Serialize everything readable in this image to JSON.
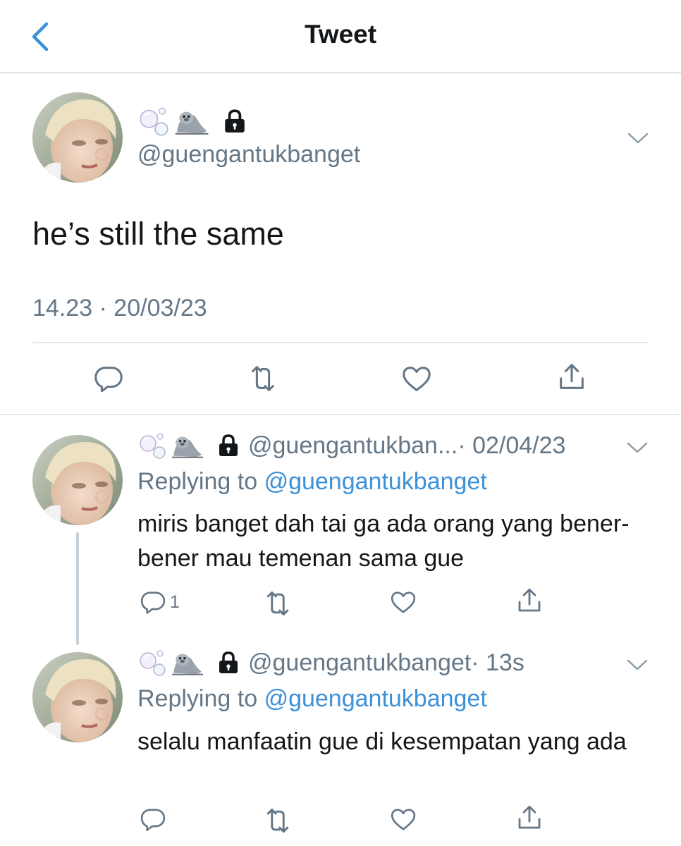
{
  "header": {
    "title": "Tweet",
    "back_icon": "chevron-left-icon"
  },
  "colors": {
    "accent": "#1da1f2",
    "link": "#3c91d9",
    "muted": "#657786",
    "divider": "#e6e9ec"
  },
  "main_tweet": {
    "display_emojis": [
      "bubbles-emoji",
      "seal-emoji"
    ],
    "protected_icon": "lock-icon",
    "handle": "@guengantukbanget",
    "text": "he’s still the same",
    "timestamp": "14.23 · 20/03/23",
    "actions": [
      "reply-icon",
      "retweet-icon",
      "like-icon",
      "share-icon"
    ]
  },
  "replies": [
    {
      "handle": "@guengantukban...",
      "time": "· 02/04/23",
      "replying_prefix": "Replying to",
      "replying_to": "@guengantukbanget",
      "text": "miris banget dah tai ga ada orang yang bener-bener mau temenan sama gue",
      "reply_count": "1"
    },
    {
      "handle": "@guengantukbanget",
      "time": "· 13s",
      "replying_prefix": "Replying to",
      "replying_to": "@guengantukbanget",
      "text": "selalu manfaatin gue di kesempatan yang ada",
      "reply_count": ""
    }
  ]
}
